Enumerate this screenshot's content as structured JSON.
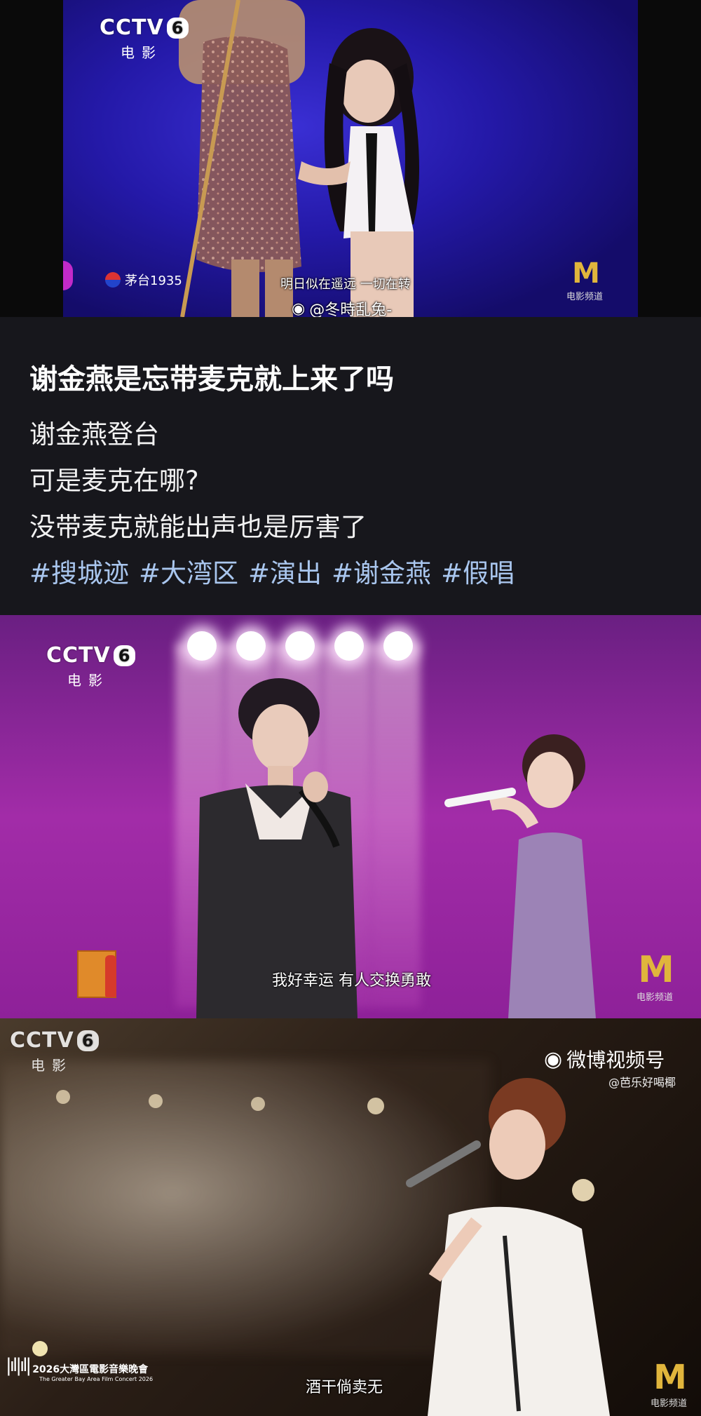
{
  "colors": {
    "background": "#17171c",
    "tag": "#a9c6ee",
    "accent_m": "#e0b53c"
  },
  "frame1": {
    "channel": "CCTV",
    "channel_num": "6",
    "channel_sub": "电影",
    "sponsor_text": "茅台1935",
    "caption": "明日似在遥远 一切在转",
    "watermark": "@冬時乱兔-",
    "m_logo_text": "电影频道"
  },
  "post": {
    "title": "谢金燕是忘带麦克就上来了吗",
    "lines": [
      "谢金燕登台",
      "可是麦克在哪?",
      "没带麦克就能出声也是厉害了"
    ],
    "tags": [
      "#搜城迹",
      "#大湾区",
      "#演出",
      "#谢金燕",
      "#假唱"
    ]
  },
  "frame2": {
    "channel": "CCTV",
    "channel_num": "6",
    "channel_sub": "电影",
    "caption": "我好幸运 有人交换勇敢",
    "m_logo_text": "电影频道"
  },
  "frame3": {
    "channel": "CCTV",
    "channel_num": "6",
    "channel_sub": "电影",
    "weibo_label": "微博视频号",
    "weibo_user": "@芭乐好喝椰",
    "caption": "酒干倘卖无",
    "event_logo_title": "2026大灣區電影音樂晚會",
    "event_logo_sub": "The Greater Bay Area Film Concert 2026",
    "m_logo_text": "电影频道"
  }
}
